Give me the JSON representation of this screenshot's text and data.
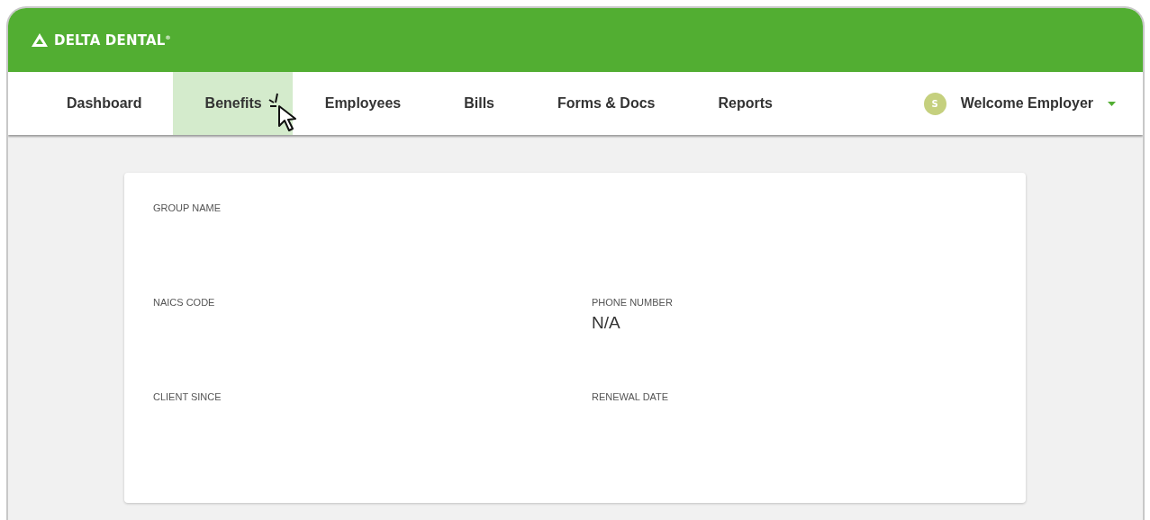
{
  "header": {
    "logo_text": "DELTA DENTAL$^{®}$"
  },
  "nav": {
    "tabs": [
      {
        "label": "Dashboard",
        "selected": false
      },
      {
        "label": "Benefits",
        "selected": true
      },
      {
        "label": "Employees",
        "selected": false
      },
      {
        "label": "Bills",
        "selected": false
      },
      {
        "label": "Forms & Docs",
        "selected": false
      },
      {
        "label": "Reports",
        "selected": false
      }
    ],
    "user": {
      "avatar_initial": "S",
      "welcome": "Welcome Employer"
    }
  },
  "card": {
    "rows": [
      [
        {
          "label": "GROUP NAME"
        }
      ],
      [
        {
          "label": "NAICS CODE"
        },
        {
          "label": "PHONE NUMBER",
          "value": "N/A"
        }
      ],
      [
        {
          "label": "CLIENT SINCE"
        },
        {
          "label": "RENEWAL DATE"
        }
      ]
    ]
  }
}
